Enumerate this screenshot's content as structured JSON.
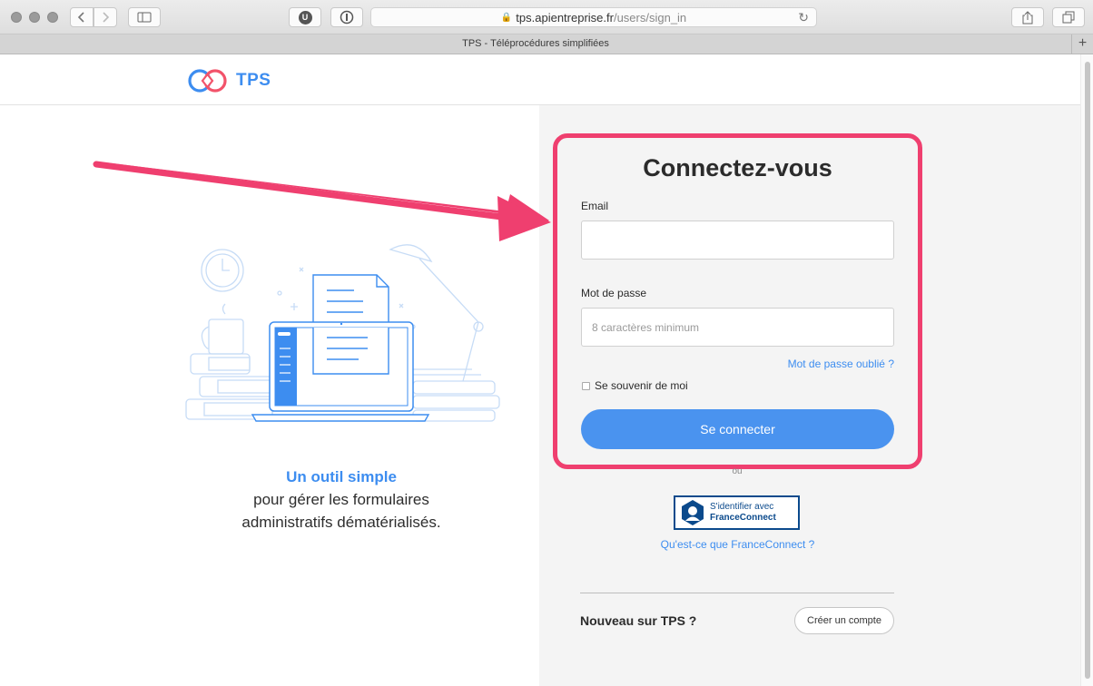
{
  "browser": {
    "url_host": "tps.apientreprise.fr",
    "url_path": "/users/sign_in",
    "tab_title": "TPS - Téléprocédures simplifiées",
    "extension_badge": "U"
  },
  "header": {
    "logo_text": "TPS"
  },
  "intro": {
    "accent": "Un outil simple",
    "line2": "pour gérer les formulaires",
    "line3": "administratifs dématérialisés."
  },
  "login": {
    "title": "Connectez-vous",
    "email_label": "Email",
    "email_value": "",
    "password_label": "Mot de passe",
    "password_placeholder": "8 caractères minimum",
    "forgot_link": "Mot de passe oublié ?",
    "remember_label": "Se souvenir de moi",
    "submit_label": "Se connecter"
  },
  "alternatives": {
    "or_text": "ou",
    "fc_line1": "S'identifier avec",
    "fc_line2": "FranceConnect",
    "fc_link": "Qu'est-ce que FranceConnect ?"
  },
  "signup": {
    "prompt": "Nouveau sur TPS ?",
    "button": "Créer un compte"
  },
  "colors": {
    "accent": "#3d8df0",
    "highlight": "#ef3f6f",
    "france_connect": "#0b4a8c"
  }
}
